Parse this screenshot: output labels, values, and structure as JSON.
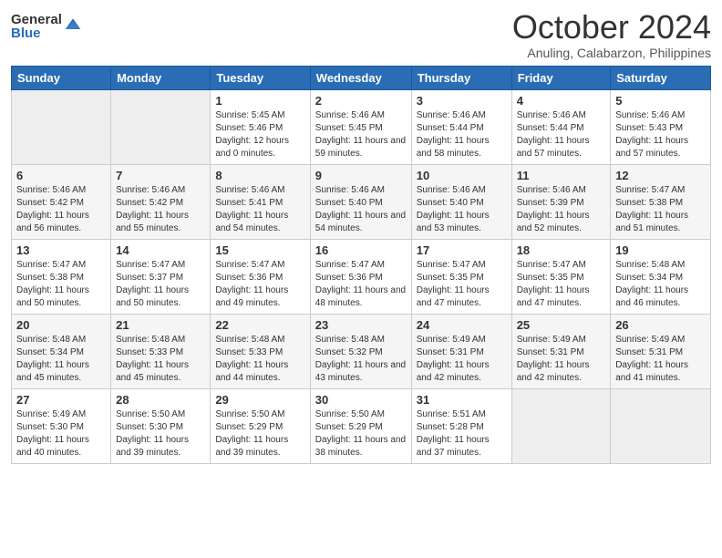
{
  "logo": {
    "general": "General",
    "blue": "Blue"
  },
  "header": {
    "month": "October 2024",
    "location": "Anuling, Calabarzon, Philippines"
  },
  "weekdays": [
    "Sunday",
    "Monday",
    "Tuesday",
    "Wednesday",
    "Thursday",
    "Friday",
    "Saturday"
  ],
  "weeks": [
    [
      {
        "day": "",
        "info": ""
      },
      {
        "day": "",
        "info": ""
      },
      {
        "day": "1",
        "info": "Sunrise: 5:45 AM\nSunset: 5:46 PM\nDaylight: 12 hours\nand 0 minutes."
      },
      {
        "day": "2",
        "info": "Sunrise: 5:46 AM\nSunset: 5:45 PM\nDaylight: 11 hours\nand 59 minutes."
      },
      {
        "day": "3",
        "info": "Sunrise: 5:46 AM\nSunset: 5:44 PM\nDaylight: 11 hours\nand 58 minutes."
      },
      {
        "day": "4",
        "info": "Sunrise: 5:46 AM\nSunset: 5:44 PM\nDaylight: 11 hours\nand 57 minutes."
      },
      {
        "day": "5",
        "info": "Sunrise: 5:46 AM\nSunset: 5:43 PM\nDaylight: 11 hours\nand 57 minutes."
      }
    ],
    [
      {
        "day": "6",
        "info": "Sunrise: 5:46 AM\nSunset: 5:42 PM\nDaylight: 11 hours\nand 56 minutes."
      },
      {
        "day": "7",
        "info": "Sunrise: 5:46 AM\nSunset: 5:42 PM\nDaylight: 11 hours\nand 55 minutes."
      },
      {
        "day": "8",
        "info": "Sunrise: 5:46 AM\nSunset: 5:41 PM\nDaylight: 11 hours\nand 54 minutes."
      },
      {
        "day": "9",
        "info": "Sunrise: 5:46 AM\nSunset: 5:40 PM\nDaylight: 11 hours\nand 54 minutes."
      },
      {
        "day": "10",
        "info": "Sunrise: 5:46 AM\nSunset: 5:40 PM\nDaylight: 11 hours\nand 53 minutes."
      },
      {
        "day": "11",
        "info": "Sunrise: 5:46 AM\nSunset: 5:39 PM\nDaylight: 11 hours\nand 52 minutes."
      },
      {
        "day": "12",
        "info": "Sunrise: 5:47 AM\nSunset: 5:38 PM\nDaylight: 11 hours\nand 51 minutes."
      }
    ],
    [
      {
        "day": "13",
        "info": "Sunrise: 5:47 AM\nSunset: 5:38 PM\nDaylight: 11 hours\nand 50 minutes."
      },
      {
        "day": "14",
        "info": "Sunrise: 5:47 AM\nSunset: 5:37 PM\nDaylight: 11 hours\nand 50 minutes."
      },
      {
        "day": "15",
        "info": "Sunrise: 5:47 AM\nSunset: 5:36 PM\nDaylight: 11 hours\nand 49 minutes."
      },
      {
        "day": "16",
        "info": "Sunrise: 5:47 AM\nSunset: 5:36 PM\nDaylight: 11 hours\nand 48 minutes."
      },
      {
        "day": "17",
        "info": "Sunrise: 5:47 AM\nSunset: 5:35 PM\nDaylight: 11 hours\nand 47 minutes."
      },
      {
        "day": "18",
        "info": "Sunrise: 5:47 AM\nSunset: 5:35 PM\nDaylight: 11 hours\nand 47 minutes."
      },
      {
        "day": "19",
        "info": "Sunrise: 5:48 AM\nSunset: 5:34 PM\nDaylight: 11 hours\nand 46 minutes."
      }
    ],
    [
      {
        "day": "20",
        "info": "Sunrise: 5:48 AM\nSunset: 5:34 PM\nDaylight: 11 hours\nand 45 minutes."
      },
      {
        "day": "21",
        "info": "Sunrise: 5:48 AM\nSunset: 5:33 PM\nDaylight: 11 hours\nand 45 minutes."
      },
      {
        "day": "22",
        "info": "Sunrise: 5:48 AM\nSunset: 5:33 PM\nDaylight: 11 hours\nand 44 minutes."
      },
      {
        "day": "23",
        "info": "Sunrise: 5:48 AM\nSunset: 5:32 PM\nDaylight: 11 hours\nand 43 minutes."
      },
      {
        "day": "24",
        "info": "Sunrise: 5:49 AM\nSunset: 5:31 PM\nDaylight: 11 hours\nand 42 minutes."
      },
      {
        "day": "25",
        "info": "Sunrise: 5:49 AM\nSunset: 5:31 PM\nDaylight: 11 hours\nand 42 minutes."
      },
      {
        "day": "26",
        "info": "Sunrise: 5:49 AM\nSunset: 5:31 PM\nDaylight: 11 hours\nand 41 minutes."
      }
    ],
    [
      {
        "day": "27",
        "info": "Sunrise: 5:49 AM\nSunset: 5:30 PM\nDaylight: 11 hours\nand 40 minutes."
      },
      {
        "day": "28",
        "info": "Sunrise: 5:50 AM\nSunset: 5:30 PM\nDaylight: 11 hours\nand 39 minutes."
      },
      {
        "day": "29",
        "info": "Sunrise: 5:50 AM\nSunset: 5:29 PM\nDaylight: 11 hours\nand 39 minutes."
      },
      {
        "day": "30",
        "info": "Sunrise: 5:50 AM\nSunset: 5:29 PM\nDaylight: 11 hours\nand 38 minutes."
      },
      {
        "day": "31",
        "info": "Sunrise: 5:51 AM\nSunset: 5:28 PM\nDaylight: 11 hours\nand 37 minutes."
      },
      {
        "day": "",
        "info": ""
      },
      {
        "day": "",
        "info": ""
      }
    ]
  ]
}
